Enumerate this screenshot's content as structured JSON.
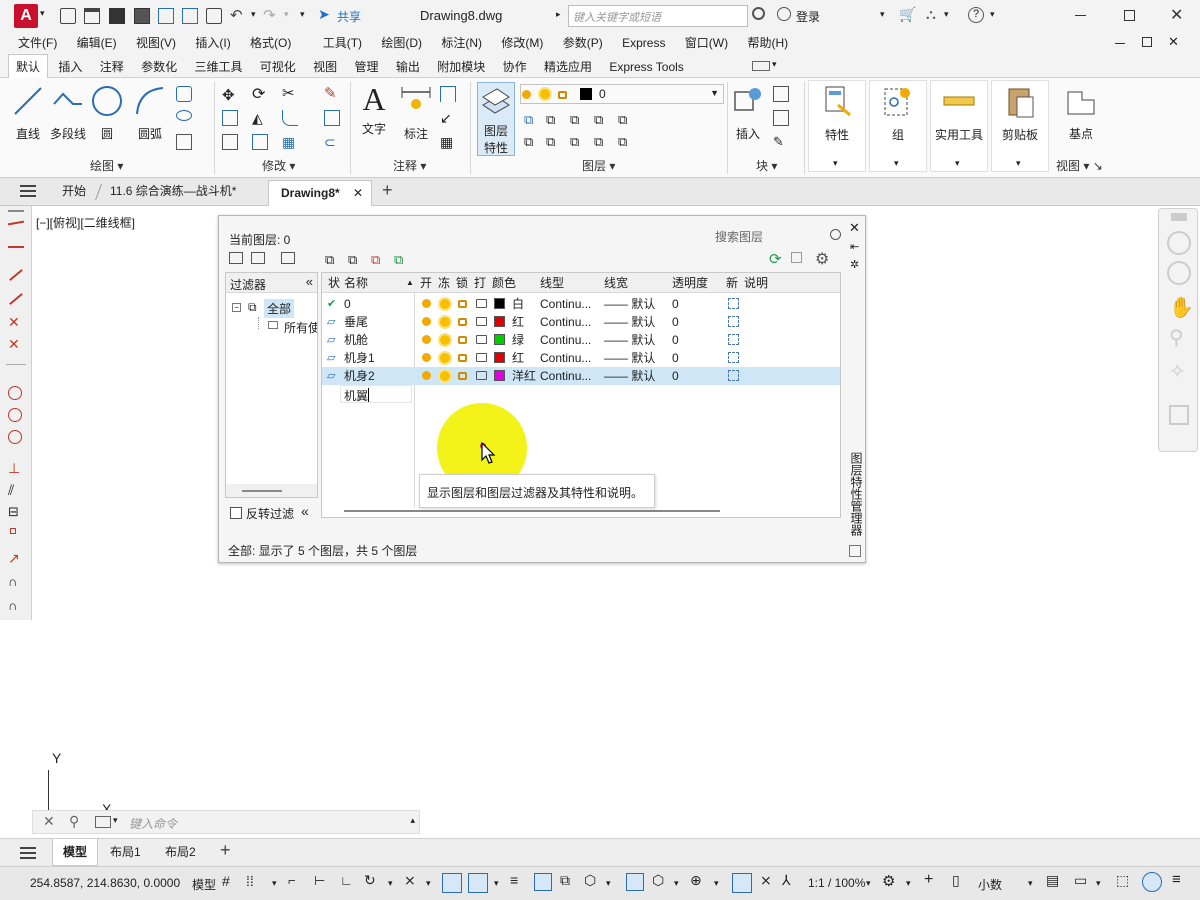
{
  "app": {
    "doc_title": "Drawing8.dwg",
    "share_label": "共享",
    "search_placeholder": "键入关键字或短语",
    "login_label": "登录"
  },
  "menu": [
    "文件(F)",
    "编辑(E)",
    "视图(V)",
    "插入(I)",
    "格式(O)",
    "工具(T)",
    "绘图(D)",
    "标注(N)",
    "修改(M)",
    "参数(P)",
    "Express",
    "窗口(W)",
    "帮助(H)"
  ],
  "ribbon_tabs": [
    "默认",
    "插入",
    "注释",
    "参数化",
    "三维工具",
    "可视化",
    "视图",
    "管理",
    "输出",
    "附加模块",
    "协作",
    "精选应用",
    "Express Tools"
  ],
  "ribbon": {
    "draw": {
      "line": "直线",
      "polyline": "多段线",
      "circle": "圆",
      "arc": "圆弧",
      "panel": "绘图"
    },
    "modify_panel": "修改",
    "annot": {
      "text": "文字",
      "dim": "标注",
      "panel": "注释"
    },
    "layer": {
      "props": "图层\n特性",
      "props_l1": "图层",
      "props_l2": "特性",
      "current": "0",
      "panel": "图层"
    },
    "block": {
      "insert": "插入",
      "panel": "块"
    },
    "props": "特性",
    "group": "组",
    "utilities": "实用工具",
    "clipboard": "剪贴板",
    "base": "基点",
    "view_panel": "视图"
  },
  "doc_tabs": [
    "开始",
    "11.6 综合演练—战斗机*",
    "Drawing8*"
  ],
  "viewport_label": "[−][俯视][二维线框]",
  "layer_manager": {
    "current_layer": "当前图层: 0",
    "search_placeholder": "搜索图层",
    "filters_label": "过滤器",
    "filter_all": "全部",
    "filter_used": "所有使",
    "invert_label": "反转过滤",
    "side_title": "图层特性管理器",
    "columns": [
      "状",
      "名称",
      "开",
      "冻",
      "锁",
      "打",
      "颜色",
      "线型",
      "线宽",
      "透明度",
      "新",
      "说明"
    ],
    "rows": [
      {
        "status": "✔",
        "name": "0",
        "color_name": "白",
        "color": "#000000",
        "linetype": "Continu...",
        "lineweight": "—— 默认",
        "transparency": "0"
      },
      {
        "status": "▱",
        "name": "垂尾",
        "color_name": "红",
        "color": "#e00000",
        "linetype": "Continu...",
        "lineweight": "—— 默认",
        "transparency": "0"
      },
      {
        "status": "▱",
        "name": "机舱",
        "color_name": "绿",
        "color": "#00cc00",
        "linetype": "Continu...",
        "lineweight": "—— 默认",
        "transparency": "0"
      },
      {
        "status": "▱",
        "name": "机身1",
        "color_name": "红",
        "color": "#e00000",
        "linetype": "Continu...",
        "lineweight": "—— 默认",
        "transparency": "0"
      },
      {
        "status": "▱",
        "name": "机身2",
        "color_name": "洋红",
        "color": "#e000e0",
        "linetype": "Continu...",
        "lineweight": "—— 默认",
        "transparency": "0"
      }
    ],
    "editing_name": "机翼",
    "tooltip": "显示图层和图层过滤器及其特性和说明。",
    "footer": "全部: 显示了 5 个图层，共 5 个图层"
  },
  "command_placeholder": "键入命令",
  "axis_y": "Y",
  "axis_x": "X",
  "layout_tabs": [
    "模型",
    "布局1",
    "布局2"
  ],
  "status": {
    "coords": "254.8587, 214.8630, 0.0000",
    "model": "模型",
    "scale": "1:1 / 100%",
    "units": "小数"
  },
  "colors": {
    "accent": "#1a73c9",
    "highlight_spot": "#f2f200",
    "selected_row": "#cfe6f7"
  }
}
